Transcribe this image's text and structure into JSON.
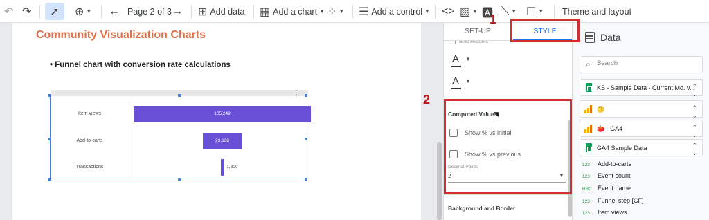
{
  "toolbar": {
    "undo_icon": "undo-icon",
    "redo_icon": "redo-icon",
    "page_indicator": "Page 2 of 3",
    "add_data_label": "Add data",
    "add_chart_label": "Add a chart",
    "add_control_label": "Add a control",
    "theme_label": "Theme and layout"
  },
  "report": {
    "title": "Community Visualization Charts",
    "bullet": "• Funnel chart with conversion rate calculations"
  },
  "chart_data": {
    "type": "bar",
    "categories": [
      "Item views",
      "Add-to-carts",
      "Transactions"
    ],
    "values": [
      105249,
      23138,
      1800
    ],
    "value_labels": [
      "105,249",
      "23,138",
      "1,800"
    ]
  },
  "properties_panel": {
    "tabs": {
      "setup": "SET-UP",
      "style": "STYLE"
    },
    "partial_text": "Bold Headers",
    "font_glyph": "A",
    "computed_values_heading": "Computed Values",
    "show_pct_initial_label": "Show % vs initial",
    "show_pct_initial_checked": false,
    "show_pct_previous_label": "Show % vs previous",
    "show_pct_previous_checked": false,
    "decimal_points_label": "Decimal Points",
    "decimal_points_value": "2",
    "background_heading": "Background and Border"
  },
  "data_panel": {
    "title": "Data",
    "search_placeholder": "Search",
    "sources": [
      {
        "name": "KS - Sample Data - Current Mo. v..."
      },
      {
        "name": "🤔"
      },
      {
        "name": "🍅 - GA4"
      },
      {
        "name": "GA4 Sample Data"
      }
    ],
    "fields": [
      {
        "type": "123",
        "name": "Add-to-carts"
      },
      {
        "type": "123",
        "name": "Event count"
      },
      {
        "type": "RBC",
        "name": "Event name"
      },
      {
        "type": "123",
        "name": "Funnel step [CF]"
      },
      {
        "type": "123",
        "name": "Item views"
      }
    ]
  },
  "callouts": {
    "one": "1",
    "two": "2"
  },
  "colors": {
    "bar": "#6750d6",
    "title": "#e0704c",
    "callout": "#d32f2f",
    "accent": "#1a73e8"
  }
}
